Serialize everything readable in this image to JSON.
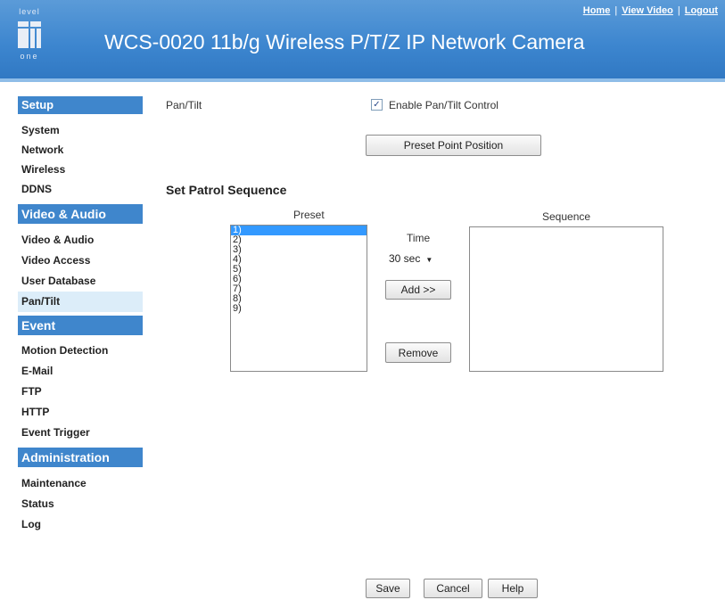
{
  "header": {
    "logo_top": "level",
    "logo_bottom": "one",
    "title": "WCS-0020 11b/g Wireless P/T/Z IP Network Camera",
    "links": {
      "home": "Home",
      "view_video": "View Video",
      "logout": "Logout"
    },
    "separator": "|"
  },
  "sidebar": {
    "setup": {
      "title": "Setup",
      "items": [
        "System",
        "Network",
        "Wireless",
        "DDNS"
      ]
    },
    "video_audio": {
      "title": "Video & Audio",
      "items": [
        "Video & Audio",
        "Video Access",
        "User Database",
        "Pan/Tilt"
      ]
    },
    "event": {
      "title": "Event",
      "items": [
        "Motion Detection",
        "E-Mail",
        "FTP",
        "HTTP",
        "Event Trigger"
      ]
    },
    "administration": {
      "title": "Administration",
      "items": [
        "Maintenance",
        "Status",
        "Log"
      ]
    },
    "active_item": "Pan/Tilt"
  },
  "main": {
    "pantilt_label": "Pan/Tilt",
    "enable_checkbox": {
      "label": "Enable Pan/Tilt Control",
      "checked": true,
      "mark": "✓"
    },
    "preset_point_button": "Preset Point Position",
    "patrol_heading": "Set Patrol Sequence",
    "preset_label": "Preset",
    "preset_options": [
      "1)",
      "2)",
      "3)",
      "4)",
      "5)",
      "6)",
      "7)",
      "8)",
      "9)"
    ],
    "preset_selected": "1)",
    "time_label": "Time",
    "time_value": "30 sec",
    "add_button": "Add >>",
    "remove_button": "Remove",
    "sequence_label": "Sequence",
    "sequence_items": []
  },
  "footer": {
    "save": "Save",
    "cancel": "Cancel",
    "help": "Help"
  },
  "colors": {
    "header_blue": "#3d86cf",
    "section_blue": "#3f86cc",
    "active_bg": "#dcedf9",
    "selection": "#3399ff"
  }
}
